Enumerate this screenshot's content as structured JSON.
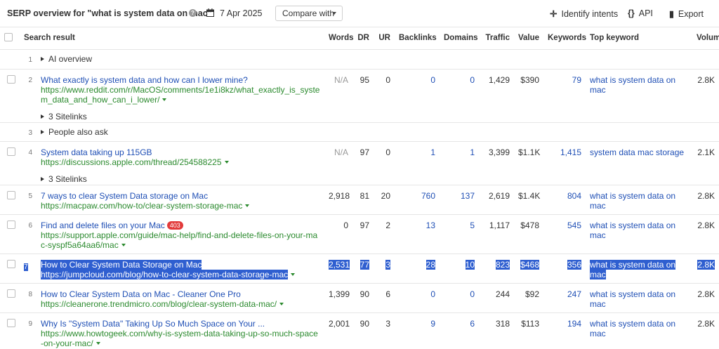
{
  "header": {
    "title": "SERP overview for \"what is system data on mac\"",
    "help_icon": "question-circle-icon",
    "date_icon": "calendar-icon",
    "date": "7 Apr 2025",
    "compare_label": "Compare with",
    "identify_label": "Identify intents",
    "api_label": "API",
    "export_label": "Export"
  },
  "columns": {
    "search_result": "Search result",
    "words": "Words",
    "dr": "DR",
    "ur": "UR",
    "backlinks": "Backlinks",
    "domains": "Domains",
    "traffic": "Traffic",
    "value": "Value",
    "keywords": "Keywords",
    "top_keyword": "Top keyword",
    "volume": "Volume"
  },
  "rows": [
    {
      "n": "1",
      "label": "AI overview"
    },
    {
      "n": "2",
      "title": "What exactly is system data and how can I lower mine?",
      "url": "https://www.reddit.com/r/MacOS/comments/1e1i8kz/what_exactly_is_system_data_and_how_can_i_lower/",
      "sitelinks": "3 Sitelinks",
      "words": "N/A",
      "dr": "95",
      "ur": "0",
      "backlinks": "0",
      "domains": "0",
      "traffic": "1,429",
      "value": "$390",
      "keywords": "79",
      "top_keyword": "what is system data on mac",
      "volume": "2.8K"
    },
    {
      "n": "3",
      "label": "People also ask"
    },
    {
      "n": "4",
      "title": "System data taking up 115GB",
      "url": "https://discussions.apple.com/thread/254588225",
      "sitelinks": "3 Sitelinks",
      "words": "N/A",
      "dr": "97",
      "ur": "0",
      "backlinks": "1",
      "domains": "1",
      "traffic": "3,399",
      "value": "$1.1K",
      "keywords": "1,415",
      "top_keyword": "system data mac storage",
      "volume": "2.1K"
    },
    {
      "n": "5",
      "title": "7 ways to clear System Data storage on Mac",
      "url": "https://macpaw.com/how-to/clear-system-storage-mac",
      "words": "2,918",
      "dr": "81",
      "ur": "20",
      "backlinks": "760",
      "domains": "137",
      "traffic": "2,619",
      "value": "$1.4K",
      "keywords": "804",
      "top_keyword": "what is system data on mac",
      "volume": "2.8K"
    },
    {
      "n": "6",
      "title": "Find and delete files on your Mac",
      "badge": "403",
      "url": "https://support.apple.com/guide/mac-help/find-and-delete-files-on-your-mac-syspf5a64aa6/mac",
      "words": "0",
      "dr": "97",
      "ur": "2",
      "backlinks": "13",
      "domains": "5",
      "traffic": "1,117",
      "value": "$478",
      "keywords": "545",
      "top_keyword": "what is system data on mac",
      "volume": "2.8K"
    },
    {
      "n": "7",
      "title": "How to Clear System Data Storage on Mac",
      "url": "https://jumpcloud.com/blog/how-to-clear-system-data-storage-mac",
      "words": "2,531",
      "dr": "77",
      "ur": "3",
      "backlinks": "28",
      "domains": "10",
      "traffic": "823",
      "value": "$468",
      "keywords": "356",
      "top_keyword": "what is system data on mac",
      "volume": "2.8K"
    },
    {
      "n": "8",
      "title": "How to Clear System Data on Mac - Cleaner One Pro",
      "url": "https://cleanerone.trendmicro.com/blog/clear-system-data-mac/",
      "words": "1,399",
      "dr": "90",
      "ur": "6",
      "backlinks": "0",
      "domains": "0",
      "traffic": "244",
      "value": "$92",
      "keywords": "247",
      "top_keyword": "what is system data on mac",
      "volume": "2.8K"
    },
    {
      "n": "9",
      "title": "Why Is \"System Data\" Taking Up So Much Space on Your ...",
      "url": "https://www.howtogeek.com/why-is-system-data-taking-up-so-much-space-on-your-mac/",
      "words": "2,001",
      "dr": "90",
      "ur": "3",
      "backlinks": "9",
      "domains": "6",
      "traffic": "318",
      "value": "$113",
      "keywords": "194",
      "top_keyword": "what is system data on mac",
      "volume": "2.8K"
    }
  ],
  "colors": {
    "link": "#1f4fb5",
    "url": "#2b8a2e",
    "selection": "#2f5fd0",
    "badge": "#e23b3b"
  }
}
